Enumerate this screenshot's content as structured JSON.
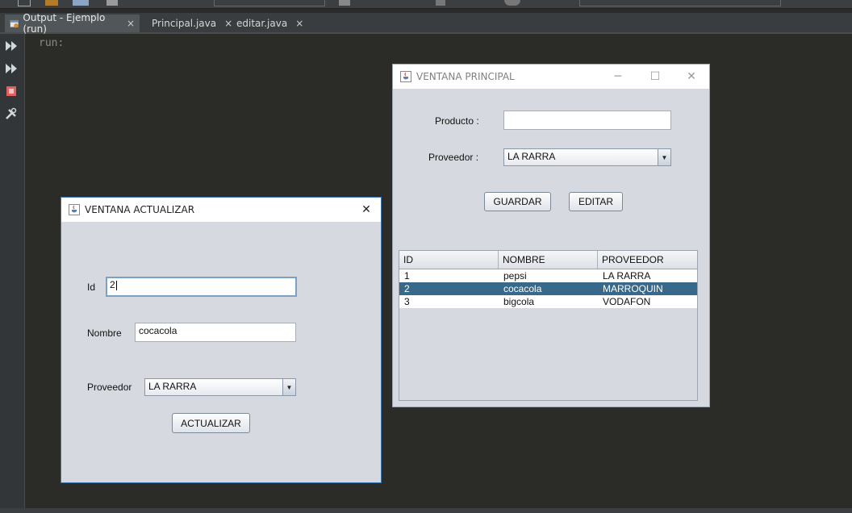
{
  "ide": {
    "run_text": "run:",
    "tabs": [
      {
        "label": "Output - Ejemplo (run)",
        "active": true
      },
      {
        "label": "Principal.java",
        "active": false
      },
      {
        "label": "editar.java",
        "active": false
      }
    ],
    "close_glyph": "×",
    "icons": [
      "rerun-icon",
      "rerun-with-options-icon",
      "stop-icon",
      "settings-icon"
    ]
  },
  "window_principal": {
    "title": "VENTANA PRINCIPAL",
    "producto_label": "Producto :",
    "producto_value": "",
    "proveedor_label": "Proveedor :",
    "proveedor_selected": "LA RARRA",
    "guardar_label": "GUARDAR",
    "editar_label": "EDITAR",
    "table": {
      "columns": [
        "ID",
        "NOMBRE",
        "PROVEEDOR"
      ],
      "rows": [
        [
          "1",
          "pepsi",
          "LA RARRA"
        ],
        [
          "2",
          "cocacola",
          "MARROQUIN"
        ],
        [
          "3",
          "bigcola",
          "VODAFON"
        ]
      ],
      "selected_row": 1
    },
    "minimize_glyph": "─",
    "maximize_glyph": "☐",
    "close_glyph": "✕"
  },
  "window_actualizar": {
    "title": "VENTANA ACTUALIZAR",
    "id_label": "Id",
    "id_value": "2",
    "nombre_label": "Nombre",
    "nombre_value": "cocacola",
    "proveedor_label": "Proveedor",
    "proveedor_selected": "LA RARRA",
    "actualizar_label": "ACTUALIZAR",
    "close_glyph": "✕"
  },
  "colors": {
    "selection": "#39698a",
    "window_bg": "#d6d9df",
    "ide_bg": "#2b2b28"
  }
}
